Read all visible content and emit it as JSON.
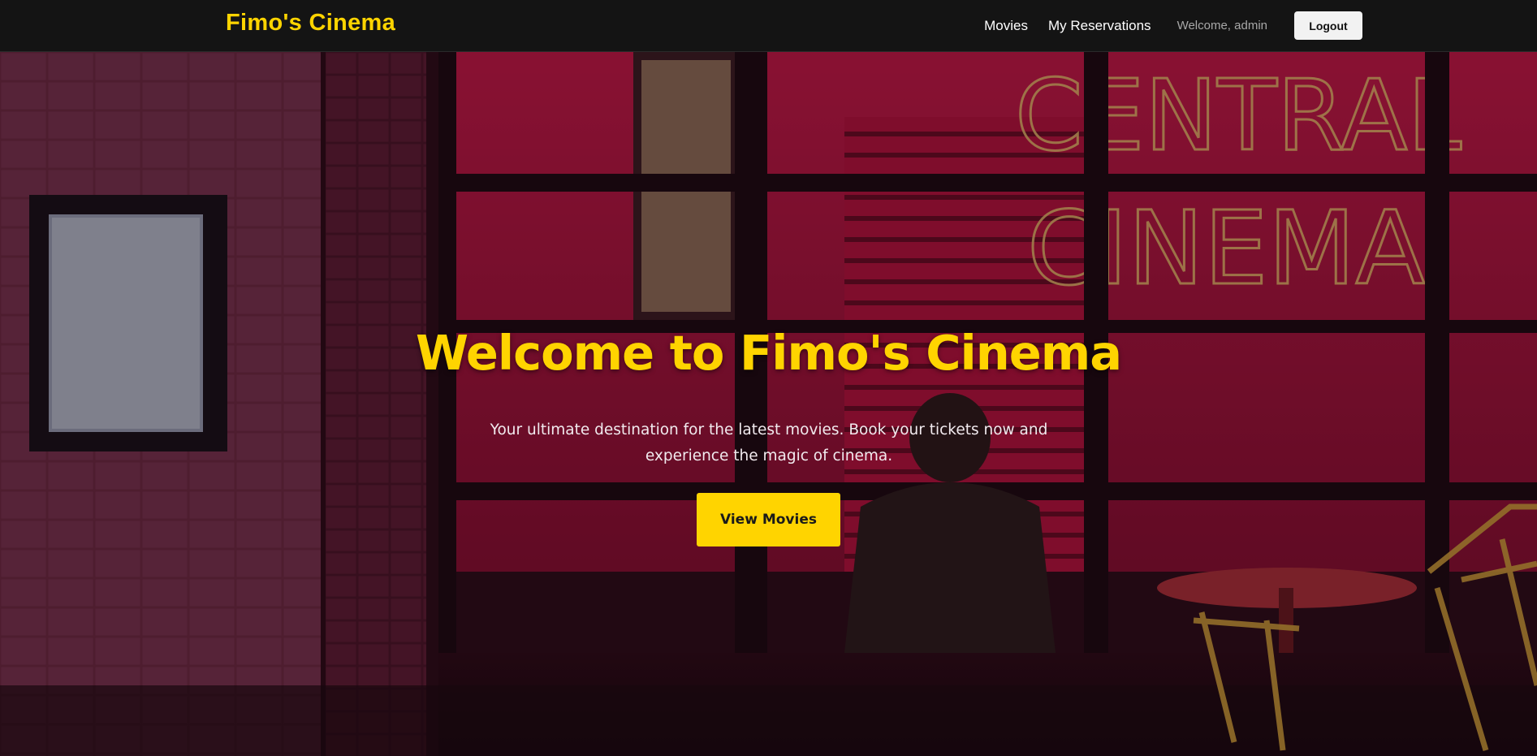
{
  "navbar": {
    "brand": "Fimo's Cinema",
    "links": {
      "movies": "Movies",
      "reservations": "My Reservations"
    },
    "welcome_text": "Welcome, admin",
    "logout_label": "Logout"
  },
  "hero": {
    "title": "Welcome to Fimo's Cinema",
    "subtitle": "Your ultimate destination for the latest movies. Book your tickets now and experience the magic of cinema.",
    "cta_label": "View Movies",
    "background_sign": {
      "line1": "CENTRAL",
      "line2": "CINEMA"
    }
  },
  "colors": {
    "accent": "#ffd400",
    "navbar_bg": "#141414",
    "hero_tint": "#c0184a"
  }
}
